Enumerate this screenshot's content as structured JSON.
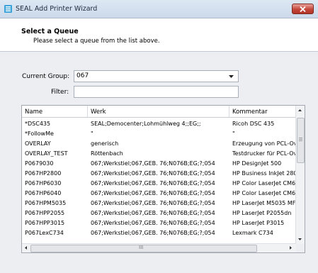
{
  "window": {
    "title": "SEAL Add Printer Wizard",
    "icon": "seal-app-icon",
    "close_icon": "close-icon"
  },
  "header": {
    "title": "Select a Queue",
    "subtitle": "Please select a queue from the list above."
  },
  "form": {
    "group_label": "Current Group:",
    "group_value": "067",
    "filter_label": "Filter:",
    "filter_value": ""
  },
  "table": {
    "columns": [
      "Name",
      "Werk",
      "Kommentar"
    ],
    "rows": [
      [
        "*DSC435",
        "SEAL;Democenter;Lohmühlweg 4;;EG;;",
        "Ricoh DSC 435"
      ],
      [
        "*FollowMe",
        "\"",
        "\""
      ],
      [
        "OVERLAY",
        "generisch",
        "Erzeugung von PCL-Overlays"
      ],
      [
        "OVERLAY_TEST",
        "Röttenbach",
        "Testdrucker für PCL-Overlays"
      ],
      [
        "P0679030",
        "067;Werkstiel;067,GEB. 76;N076B;EG;?;054",
        "HP DesignJet 500"
      ],
      [
        "P067HP2800",
        "067;Werkstiel;067,GEB. 76;N076B;EG;?;054",
        "HP Business InkJet 2800"
      ],
      [
        "P067HP6030",
        "067;Werkstiel;067,GEB. 76;N076B;EG;?;054",
        "HP Color LaserJet CM6030"
      ],
      [
        "P067HP6040",
        "067;Werkstiel;067,GEB. 76;N076B;EG;?;054",
        "HP Color LaserJet CM6040"
      ],
      [
        "P067HPM5035",
        "067;Werkstiel;067,GEB. 76;N076B;EG;?;054",
        "HP LaserJet M5035 MFP"
      ],
      [
        "P067HPP2055",
        "067;Werkstiel;067,GEB. 76;N076B;EG;?;054",
        "HP LaserJet P2055dn"
      ],
      [
        "P067HPP3015",
        "067;Werkstiel;067,GEB. 76;N076B;EG;?;054",
        "HP LaserJet P3015"
      ],
      [
        "P067LexC734",
        "067;Werkstiel;067,GEB. 76;N076B;EG;?;054",
        "Lexmark C734"
      ]
    ],
    "hscroll_grip": "III"
  },
  "colors": {
    "titlebar": "#cbd9ea",
    "close_button": "#c4463a",
    "background": "#eceef2"
  }
}
